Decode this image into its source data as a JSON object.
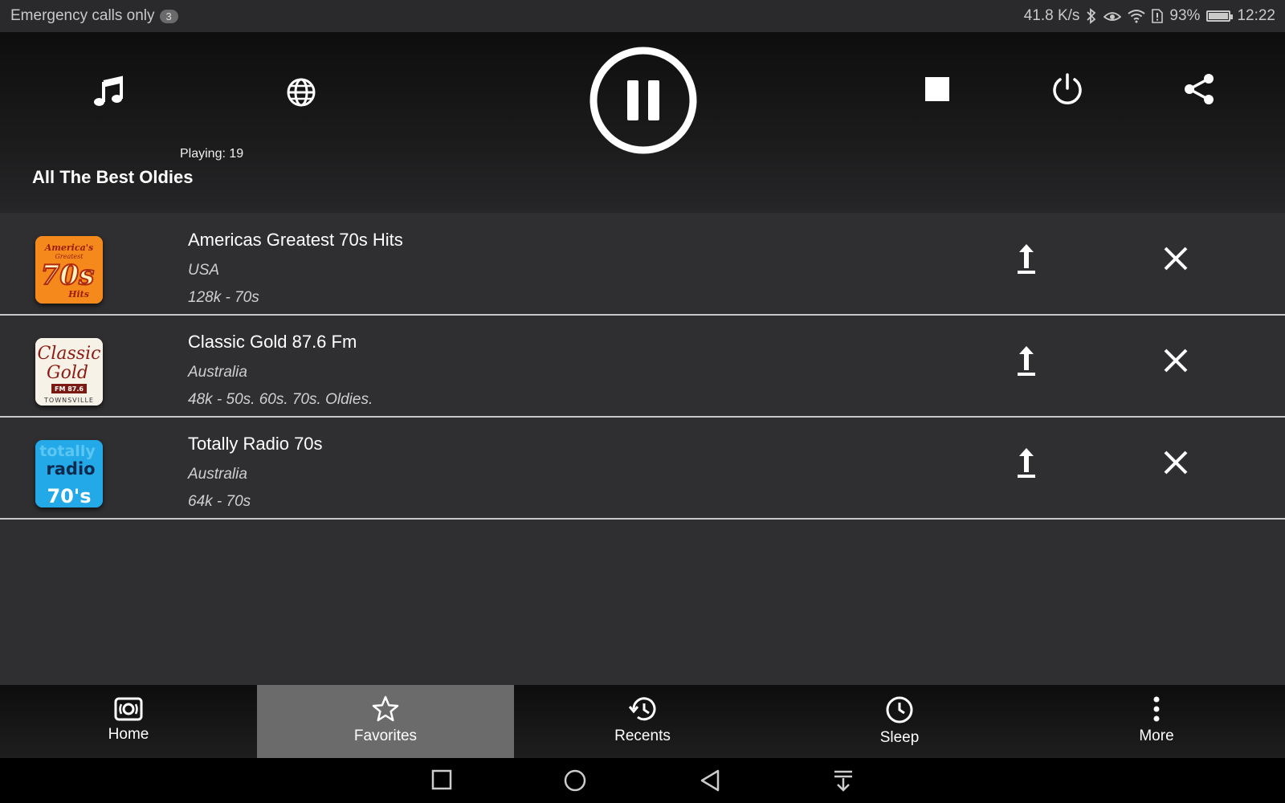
{
  "status_bar": {
    "carrier": "Emergency calls only",
    "badge_count": "3",
    "net_speed": "41.8 K/s",
    "battery_percent": "93%",
    "time": "12:22",
    "icons": [
      "bluetooth-icon",
      "eye-comfort-icon",
      "wifi-icon",
      "sim-icon",
      "battery-icon"
    ]
  },
  "player": {
    "playing_label": "Playing: 19",
    "station_title": "All The Best Oldies",
    "icons": [
      "music-note-icon",
      "globe-icon",
      "pause-icon",
      "stop-icon",
      "power-icon",
      "share-icon"
    ]
  },
  "favorites": [
    {
      "name": "Americas Greatest 70s Hits",
      "country": "USA",
      "info": "128k - 70s",
      "logo": "americas-greatest-70s-logo",
      "logo_text": [
        "America's",
        "Greatest",
        "70s",
        "Hits"
      ]
    },
    {
      "name": "Classic Gold 87.6 Fm",
      "country": "Australia",
      "info": "48k - 50s. 60s. 70s. Oldies.",
      "logo": "classic-gold-logo",
      "logo_text": [
        "Classic",
        "Gold",
        "FM 87.6",
        "TOWNSVILLE"
      ]
    },
    {
      "name": "Totally Radio 70s",
      "country": "Australia",
      "info": "64k - 70s",
      "logo": "totally-radio-70s-logo",
      "logo_text": [
        "totally",
        "radio",
        "70's"
      ]
    }
  ],
  "bottom_nav": [
    {
      "label": "Home",
      "icon": "radio-icon"
    },
    {
      "label": "Favorites",
      "icon": "star-icon",
      "active": true
    },
    {
      "label": "Recents",
      "icon": "history-icon"
    },
    {
      "label": "Sleep",
      "icon": "clock-icon"
    },
    {
      "label": "More",
      "icon": "more-vertical-icon"
    }
  ],
  "system_nav": [
    "recents-square-icon",
    "home-circle-icon",
    "back-triangle-icon",
    "notification-pull-icon"
  ]
}
